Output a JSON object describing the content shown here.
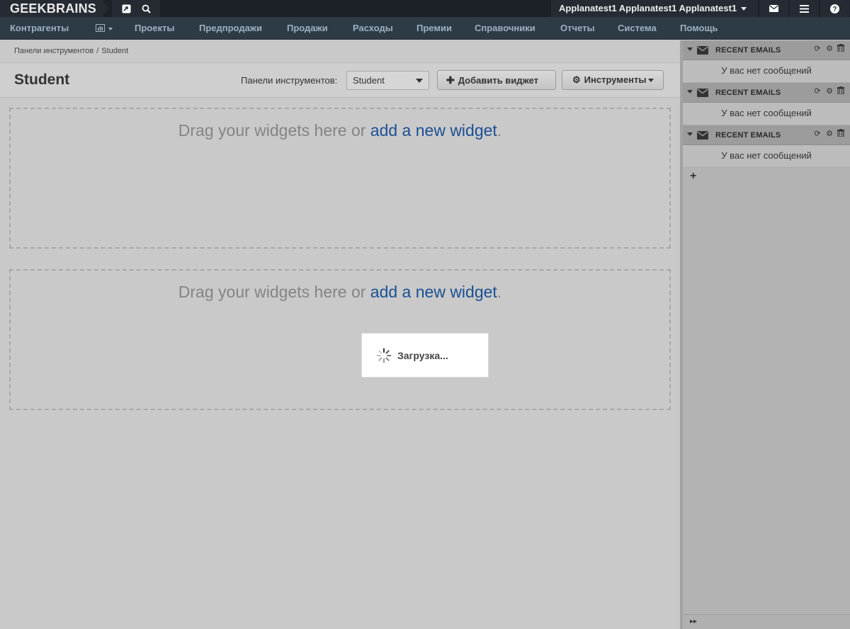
{
  "topbar": {
    "logo": "GEEKBRAINS",
    "user_name": "Applanatest1 Applanatest1 Applanatest1",
    "icons": [
      "share-icon",
      "search-icon",
      "envelope-icon",
      "menu-icon",
      "help-icon"
    ]
  },
  "nav": {
    "items": [
      "Контрагенты",
      "Проекты",
      "Предпродажи",
      "Продажи",
      "Расходы",
      "Премии",
      "Справочники",
      "Отчеты",
      "Система",
      "Помощь"
    ]
  },
  "breadcrumb": {
    "parent": "Панели инструментов",
    "separator": "/",
    "current": "Student"
  },
  "header": {
    "title": "Student",
    "dashboard_label": "Панели инструментов:",
    "dashboard_value": "Student",
    "add_widget_label": "Добавить виджет",
    "tools_label": "Инструменты"
  },
  "dropzone": {
    "text": "Drag your widgets here or ",
    "link": "add a new widget",
    "suffix": "."
  },
  "loading": {
    "text": "Загрузка..."
  },
  "sidebar": {
    "widgets": [
      {
        "title": "RECENT EMAILS",
        "empty_text": "У вас нет сообщений"
      },
      {
        "title": "RECENT EMAILS",
        "empty_text": "У вас нет сообщений"
      },
      {
        "title": "RECENT EMAILS",
        "empty_text": "У вас нет сообщений"
      }
    ],
    "add_label": "+"
  },
  "colors": {
    "topbar": "#1c2027",
    "navbar": "#2d3b47",
    "link": "#1a4f93"
  }
}
